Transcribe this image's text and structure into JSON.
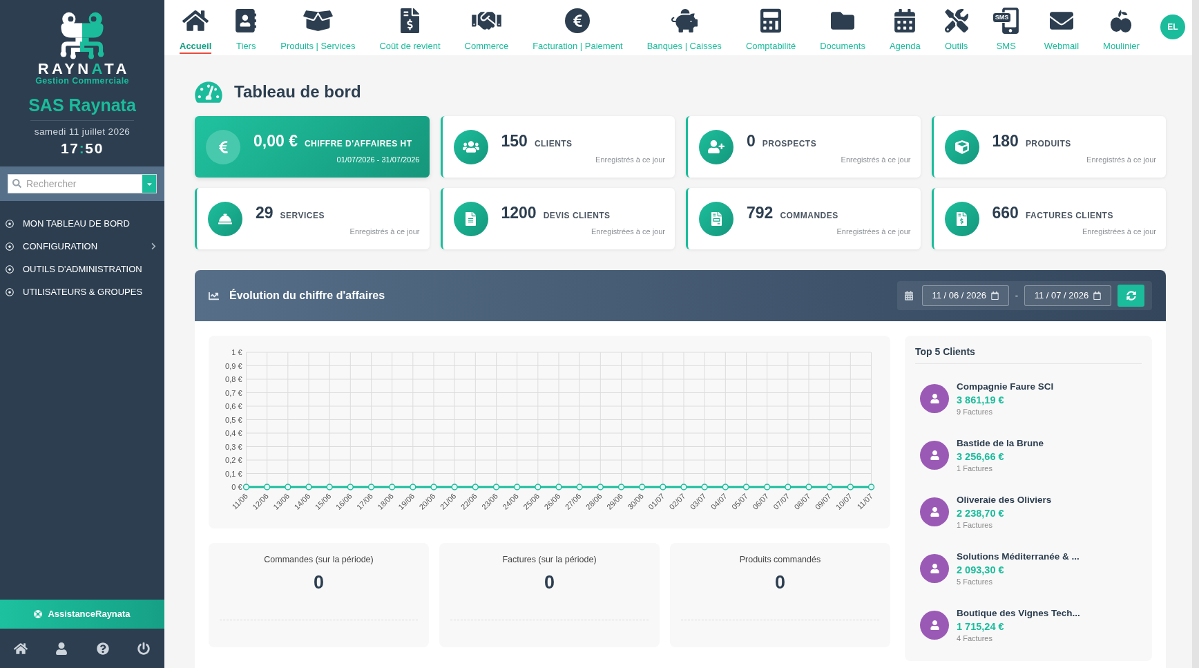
{
  "sidebar": {
    "logo": {
      "wordmark": [
        {
          "text": "RAYN",
          "accent": false
        },
        {
          "text": "A",
          "accent": true
        },
        {
          "text": "TA",
          "accent": false
        }
      ],
      "tagline": "Gestion Commerciale"
    },
    "company": "SAS Raynata",
    "date": "samedi 11 juillet 2026",
    "time": {
      "hours": "17",
      "separator": ":",
      "minutes": "50"
    },
    "search": {
      "placeholder": "Rechercher"
    },
    "menu": [
      {
        "label": "MON TABLEAU DE BORD",
        "selected": false,
        "has_submenu": false
      },
      {
        "label": "CONFIGURATION",
        "selected": false,
        "has_submenu": true
      },
      {
        "label": "OUTILS D'ADMINISTRATION",
        "selected": false,
        "has_submenu": false
      },
      {
        "label": "UTILISATEURS & GROUPES",
        "selected": false,
        "has_submenu": false
      }
    ],
    "assistance": {
      "label": "AssistanceRaynata"
    }
  },
  "top_nav": {
    "items": [
      {
        "label": "Accueil",
        "selected": true
      },
      {
        "label": "Tiers",
        "selected": false
      },
      {
        "label": "Produits | Services",
        "selected": false
      },
      {
        "label": "Coût de revient",
        "selected": false
      },
      {
        "label": "Commerce",
        "selected": false
      },
      {
        "label": "Facturation | Paiement",
        "selected": false
      },
      {
        "label": "Banques | Caisses",
        "selected": false
      },
      {
        "label": "Comptabilité",
        "selected": false
      },
      {
        "label": "Documents",
        "selected": false
      },
      {
        "label": "Agenda",
        "selected": false
      },
      {
        "label": "Outils",
        "selected": false
      },
      {
        "label": "SMS",
        "selected": false,
        "icon_text": "SMS"
      },
      {
        "label": "Webmail",
        "selected": false
      },
      {
        "label": "Moulinier",
        "selected": false
      }
    ],
    "user_avatar": {
      "initials": "EL"
    }
  },
  "page": {
    "title": "Tableau de bord"
  },
  "stat_cards": [
    {
      "kind": "highlight",
      "value": "0,00 €",
      "label": "CHIFFRE D'AFFAIRES HT",
      "subtitle": "01/07/2026 - 31/07/2026"
    },
    {
      "kind": "count",
      "value": "150",
      "label": "CLIENTS",
      "subtitle": "Enregistrés à ce jour"
    },
    {
      "kind": "count",
      "value": "0",
      "label": "PROSPECTS",
      "subtitle": "Enregistrés à ce jour"
    },
    {
      "kind": "count",
      "value": "180",
      "label": "PRODUITS",
      "subtitle": "Enregistrés à ce jour"
    },
    {
      "kind": "count",
      "value": "29",
      "label": "SERVICES",
      "subtitle": "Enregistrés à ce jour"
    },
    {
      "kind": "count",
      "value": "1200",
      "label": "DEVIS CLIENTS",
      "subtitle": "Enregistrées à ce jour"
    },
    {
      "kind": "count",
      "value": "792",
      "label": "COMMANDES",
      "subtitle": "Enregistrées à ce jour"
    },
    {
      "kind": "count",
      "value": "660",
      "label": "FACTURES CLIENTS",
      "subtitle": "Enregistrées à ce jour"
    }
  ],
  "revenue_panel": {
    "title": "Évolution du chiffre d'affaires",
    "date_from": {
      "value": "11 / 06 / 2026"
    },
    "separator": "-",
    "date_to": {
      "value": "11 / 07 / 2026"
    },
    "chart_data": {
      "type": "line",
      "grid": true,
      "categories": [
        "11/06",
        "12/06",
        "13/06",
        "14/06",
        "15/06",
        "16/06",
        "17/06",
        "18/06",
        "19/06",
        "20/06",
        "21/06",
        "22/06",
        "23/06",
        "24/06",
        "25/06",
        "26/06",
        "27/06",
        "28/06",
        "29/06",
        "30/06",
        "01/07",
        "02/07",
        "03/07",
        "04/07",
        "05/07",
        "06/07",
        "07/07",
        "08/07",
        "09/07",
        "10/07",
        "11/07"
      ],
      "series": [
        {
          "color": "#1abc9c",
          "marker": "circle",
          "values": [
            0,
            0,
            0,
            0,
            0,
            0,
            0,
            0,
            0,
            0,
            0,
            0,
            0,
            0,
            0,
            0,
            0,
            0,
            0,
            0,
            0,
            0,
            0,
            0,
            0,
            0,
            0,
            0,
            0,
            0,
            0
          ]
        }
      ],
      "ylim": [
        0,
        1
      ],
      "yticks": [
        {
          "value": 0,
          "label": "0 €"
        },
        {
          "value": 0.1,
          "label": "0,1 €"
        },
        {
          "value": 0.2,
          "label": "0,2 €"
        },
        {
          "value": 0.3,
          "label": "0,3 €"
        },
        {
          "value": 0.4,
          "label": "0,4 €"
        },
        {
          "value": 0.5,
          "label": "0,5 €"
        },
        {
          "value": 0.6,
          "label": "0,6 €"
        },
        {
          "value": 0.7,
          "label": "0,7 €"
        },
        {
          "value": 0.8,
          "label": "0,8 €"
        },
        {
          "value": 0.9,
          "label": "0,9 €"
        },
        {
          "value": 1,
          "label": "1 €"
        }
      ]
    },
    "summaries": [
      {
        "label": "Commandes (sur la période)",
        "value": "0"
      },
      {
        "label": "Factures (sur la période)",
        "value": "0"
      },
      {
        "label": "Produits commandés",
        "value": "0"
      }
    ],
    "top_clients": {
      "title": "Top 5 Clients",
      "items": [
        {
          "name": "Compagnie Faure SCI",
          "amount": "3 861,19 €",
          "invoices": "9 Factures"
        },
        {
          "name": "Bastide de la Brune",
          "amount": "3 256,66 €",
          "invoices": "1 Factures"
        },
        {
          "name": "Oliveraie des Oliviers",
          "amount": "2 238,70 €",
          "invoices": "1 Factures"
        },
        {
          "name": "Solutions Méditerranée & ...",
          "amount": "2 093,30 €",
          "invoices": "5 Factures"
        },
        {
          "name": "Boutique des Vignes Tech...",
          "amount": "1 715,24 €",
          "invoices": "4 Factures"
        }
      ]
    }
  }
}
